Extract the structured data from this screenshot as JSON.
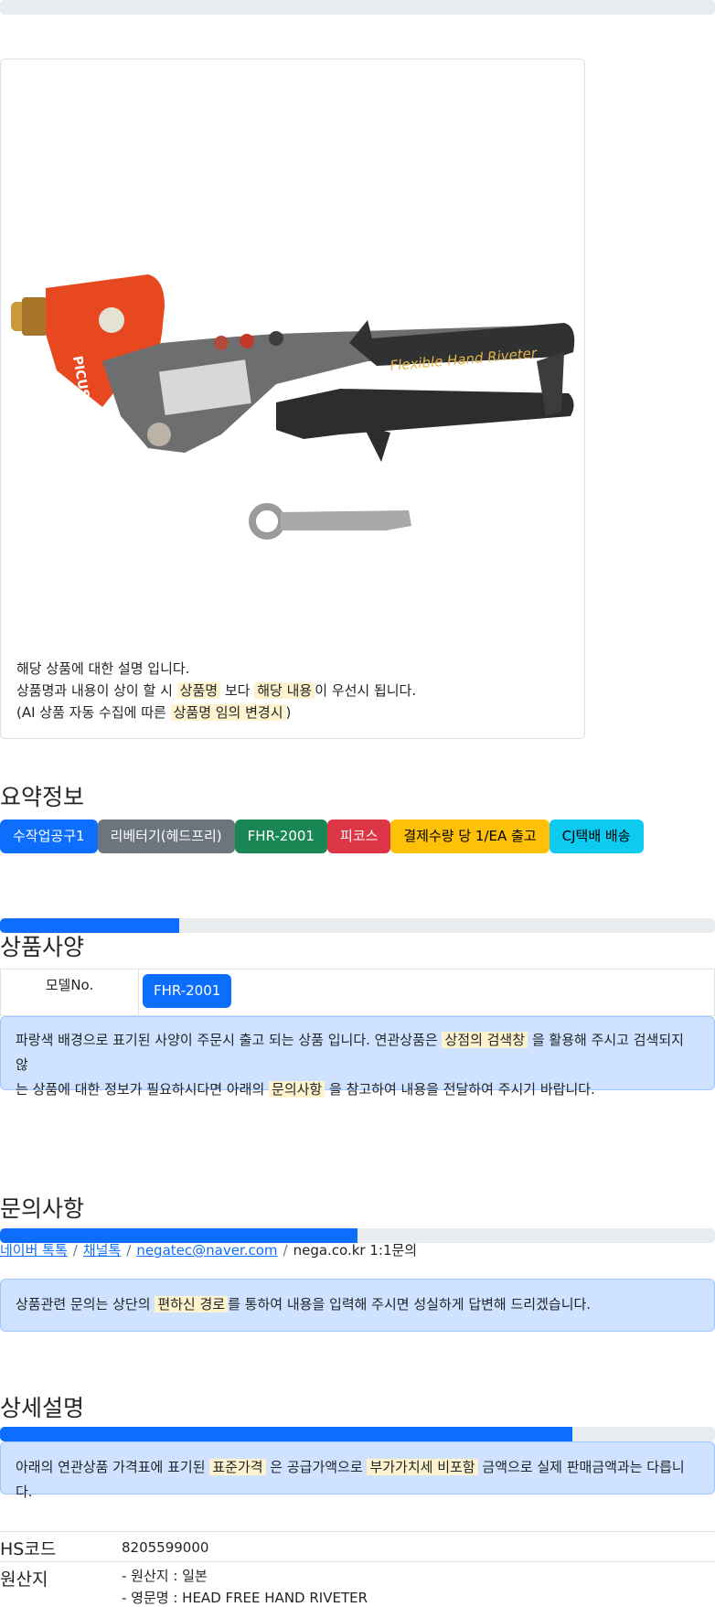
{
  "product_card": {
    "image_label": "Flexible Hand Riveter",
    "brand_label": "PICUS",
    "desc_line1": "해당 상품에 대한 설명 입니다.",
    "desc_line2_a": "상품명과 내용이 상이 할 시",
    "desc_line2_mark1": "상품명",
    "desc_line2_b": "보다",
    "desc_line2_mark2": "해당 내용",
    "desc_line2_c": "이 우선시 됩니다.",
    "desc_line3_a": "(AI 상품 자동 수집에 따른",
    "desc_line3_mark": "상품명 임의 변경시",
    "desc_line3_b": ")"
  },
  "summary": {
    "title": "요약정보",
    "badges": [
      {
        "label": "수작업공구1",
        "color": "#0d6efd"
      },
      {
        "label": "리베터기(헤드프리)",
        "color": "#6c757d"
      },
      {
        "label": "FHR-2001",
        "color": "#198754"
      },
      {
        "label": "피코스",
        "color": "#dc3545"
      },
      {
        "label": "결제수량 당 1/EA 출고",
        "color": "#ffc107"
      },
      {
        "label": "CJ택배 배송",
        "color": "#0dcaf0"
      }
    ]
  },
  "spec": {
    "progress_pct": 25,
    "title": "상품사양",
    "model_label": "모델No.",
    "model_value": "FHR-2001",
    "alert_a": "파랑색 배경으로 표기된 사양이 주문시 출고 되는 상품 입니다. 연관상품은",
    "alert_mark1": "상점의 검색창",
    "alert_b": "을 활용해 주시고 검색되지 않",
    "alert_c": "는 상품에 대한 정보가 필요하시다면 아래의",
    "alert_mark2": "문의사항",
    "alert_d": "을 참고하여 내용을 전달하여 주시기 바랍니다."
  },
  "inquiry": {
    "title": "문의사항",
    "progress_pct": 50,
    "links": [
      "네이버 톡톡",
      "채널톡",
      "negatec@naver.com"
    ],
    "plain": "nega.co.kr 1:1문의",
    "alert_a": "상품관련 문의는 상단의",
    "alert_mark": "편하신 경로",
    "alert_b": "를 통하여 내용을 입력해 주시면 성실하게 답변해 드리겠습니다."
  },
  "detail": {
    "title": "상세설명",
    "progress_pct": 80,
    "alert_a": "아래의 연관상품 가격표에 표기된",
    "alert_mark1": "표준가격",
    "alert_b": "은 공급가액으로",
    "alert_mark2": "부가가치세 비포함",
    "alert_c": "금액으로 실제 판매금액과는 다릅니다."
  },
  "info": {
    "hs_label": "HS코드",
    "hs_value": "8205599000",
    "origin_label": "원산지",
    "origin_line1": "- 원산지 : 일본",
    "origin_line2": "- 영문명 : HEAD FREE HAND RIVETER"
  }
}
